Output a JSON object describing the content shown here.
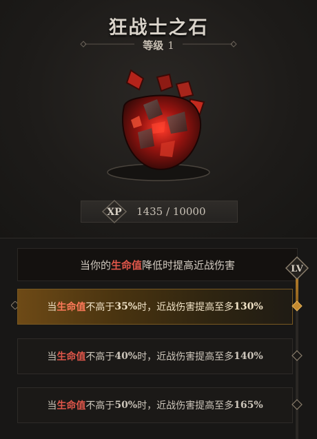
{
  "title": "狂战士之石",
  "level": {
    "label": "等级",
    "value": "1"
  },
  "xp": {
    "badge": "XP",
    "current_text": "1435 / 10000",
    "current": 1435,
    "max": 10000
  },
  "effect": {
    "prefix": "当你的",
    "keyword": "生命值",
    "suffix": "降低时提高近战伤害"
  },
  "lv_badge": "LV",
  "tiers": [
    {
      "a": "当",
      "kw": "生命值",
      "b": "不高于",
      "threshold": "35%",
      "c": "时，近战伤害提高至多",
      "bonus": "130%",
      "active": true
    },
    {
      "a": "当",
      "kw": "生命值",
      "b": "不高于",
      "threshold": "40%",
      "c": "时，近战伤害提高至多",
      "bonus": "140%",
      "active": false
    },
    {
      "a": "当",
      "kw": "生命值",
      "b": "不高于",
      "threshold": "50%",
      "c": "时，近战伤害提高至多",
      "bonus": "165%",
      "active": false
    }
  ],
  "colors": {
    "keyword_red": "#e0564a",
    "active_gold": "#6e4a16",
    "accent": "#c48a30"
  },
  "icons": {
    "gem": "blood-heart-gem-icon",
    "xp": "xp-badge-icon",
    "lv": "lv-badge-icon"
  }
}
